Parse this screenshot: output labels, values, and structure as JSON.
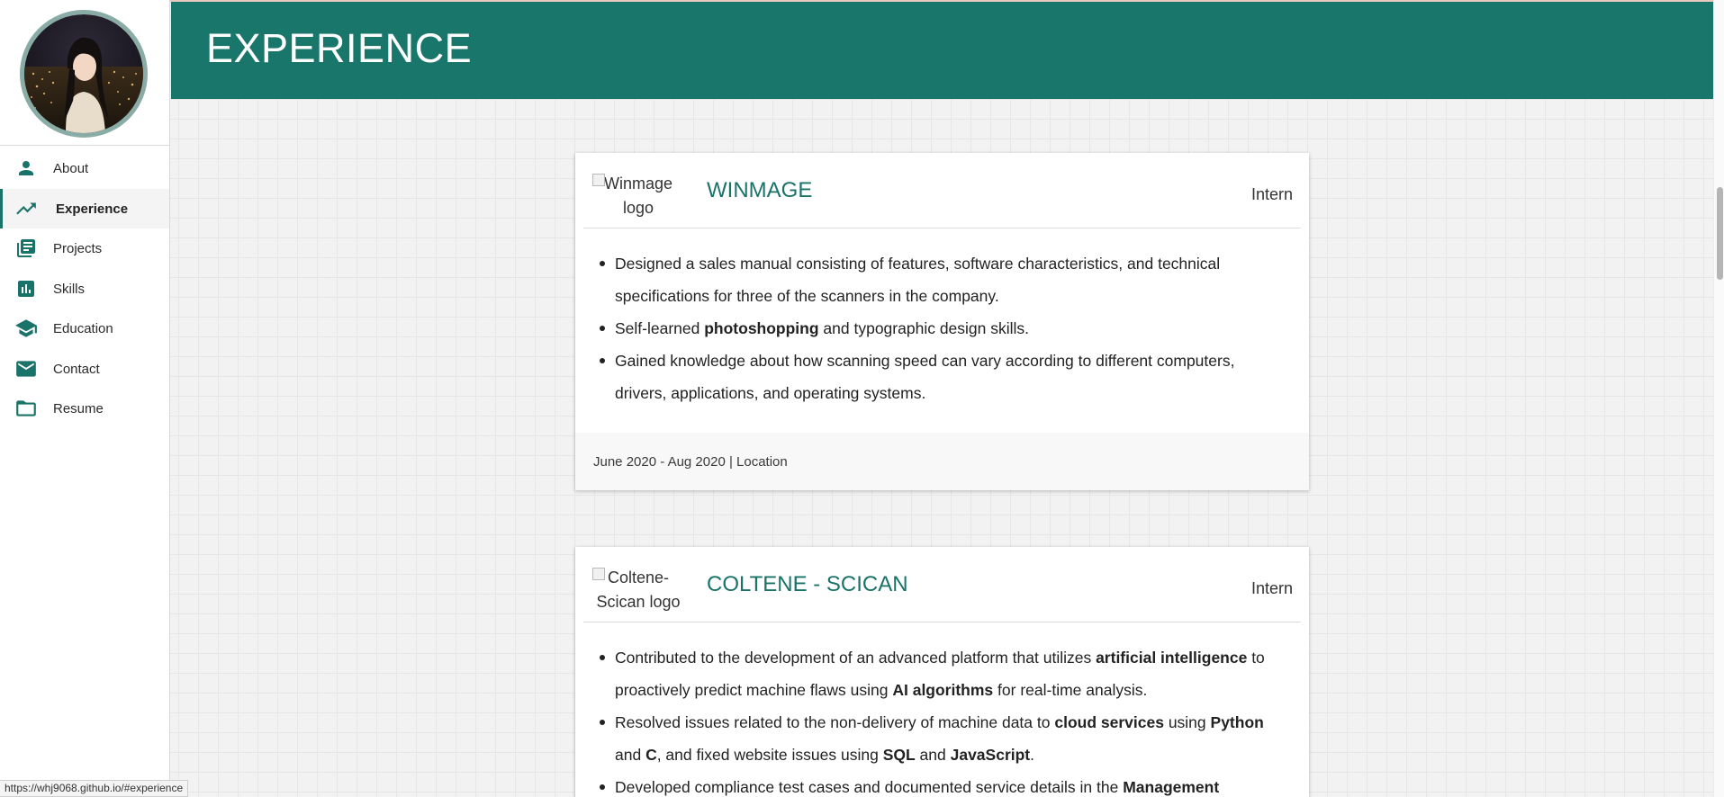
{
  "header": {
    "title": "EXPERIENCE"
  },
  "sidebar": {
    "items": [
      {
        "label": "About",
        "icon": "person-icon"
      },
      {
        "label": "Experience",
        "icon": "trending-up-icon"
      },
      {
        "label": "Projects",
        "icon": "library-books-icon"
      },
      {
        "label": "Skills",
        "icon": "bar-chart-icon"
      },
      {
        "label": "Education",
        "icon": "school-icon"
      },
      {
        "label": "Contact",
        "icon": "mail-icon"
      },
      {
        "label": "Resume",
        "icon": "folder-icon"
      }
    ]
  },
  "experiences": [
    {
      "logo_alt_line1": "Winmage",
      "logo_alt_line2": "logo",
      "company": "WINMAGE",
      "role": "Intern",
      "bullets": [
        "Designed a sales manual consisting of features, software characteristics, and technical specifications for three of the scanners in the company.",
        {
          "before": "Self-learned ",
          "bold": "photoshopping",
          "after": " and typographic design skills."
        },
        "Gained knowledge about how scanning speed can vary according to different computers, drivers, applications, and operating systems."
      ],
      "footer": "June 2020 - Aug 2020 | Location"
    },
    {
      "logo_alt_line1": "Coltene-",
      "logo_alt_line2": "Scican logo",
      "company": "COLTENE - SCICAN",
      "role": "Intern",
      "bullet1": {
        "a": "Contributed to the development of an advanced platform that utilizes ",
        "b": "artificial intelligence",
        "c": " to proactively predict machine flaws using ",
        "d": "AI algorithms",
        "e": " for real-time analysis."
      },
      "bullet2": {
        "a": "Resolved issues related to the non-delivery of machine data to ",
        "b": "cloud services",
        "c": " using ",
        "d": "Python",
        "e": " and ",
        "f": "C",
        "g": ", and fixed website issues using ",
        "h": "SQL",
        "i": " and ",
        "j": "JavaScript",
        "k": "."
      },
      "bullet3": {
        "a": "Developed compliance test cases and documented service details in the ",
        "b": "Management"
      }
    }
  ],
  "status_url": "https://whj9068.github.io/#experience",
  "colors": {
    "accent": "#19766b",
    "link": "#1a7369"
  }
}
